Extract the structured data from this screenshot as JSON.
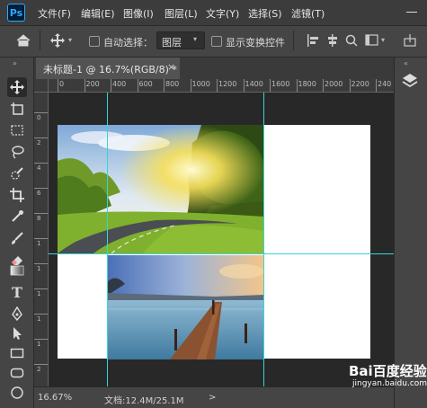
{
  "app": {
    "logo": "Ps"
  },
  "menu": [
    "文件(F)",
    "编辑(E)",
    "图像(I)",
    "图层(L)",
    "文字(Y)",
    "选择(S)",
    "滤镜(T)"
  ],
  "options": {
    "auto_select_label": "自动选择：",
    "layer_select_value": "图层",
    "show_transform_label": "显示变换控件"
  },
  "document": {
    "tab_title": "未标题-1 @ 16.7%(RGB/8) *",
    "close_glyph": "×"
  },
  "ruler": {
    "top_labels": [
      "0",
      "200",
      "400",
      "600",
      "800",
      "1000",
      "1200",
      "1400",
      "1600",
      "1800",
      "2000",
      "2200",
      "240"
    ],
    "left_labels": [
      "0",
      "2",
      "4",
      "6",
      "8",
      "1",
      "1",
      "1",
      "1",
      "1",
      "2"
    ]
  },
  "status": {
    "zoom": "16.67%",
    "doc_info": "文档:12.4M/25.1M",
    "arrow": ">"
  },
  "watermark": {
    "logo": "Bai百度经验",
    "url": "jingyan.baidu.com"
  },
  "colors": {
    "guide": "#35d6d6",
    "accent": "#31a8ff"
  }
}
